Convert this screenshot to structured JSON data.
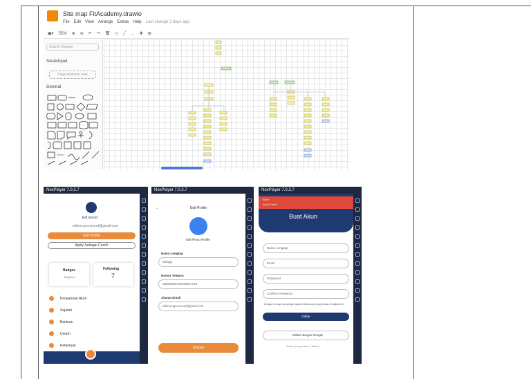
{
  "drawio": {
    "title": "Site map FitAcademy.drawio",
    "menu": [
      "File",
      "Edit",
      "View",
      "Arrange",
      "Extras",
      "Help",
      "Last change 3 days ago"
    ],
    "zoom": "55%",
    "search_placeholder": "Search Shapes",
    "scratchpad": "Scratchpad",
    "drag_hint": "Drag elements here",
    "general": "General"
  },
  "phone1": {
    "app": "NoxPlayer 7.0.2.7",
    "name": "Edi secret",
    "email": "ediencrypt.secret@gmail.com",
    "edit_profile": "Edit Profile",
    "apply": "Apply Sebagai Coach",
    "badges_label": "Badges",
    "badges_value": "Beginner",
    "following_label": "Following",
    "following_value": "7",
    "menu": [
      "Pengaturan Akun",
      "Sejarah",
      "Bantuan",
      "Unduh",
      "Ketentuan"
    ]
  },
  "phone2": {
    "app": "NoxPlayer 7.0.2.7",
    "header": "Edit Profile",
    "photo_label": "Edit Photo Profile",
    "name_label": "Nama Lengkap",
    "name_value": "Edingg",
    "phone_label": "Nomor Telepon",
    "phone_value": "08584960720945687765",
    "email_label": "Alamat Email",
    "email_value": "ediencrypt.secret@gmail.com",
    "save": "Simpan"
  },
  "phone3": {
    "app": "NoxPlayer 7.0.2.7",
    "error_title": "Error",
    "error_msg": "Input Failed",
    "heading": "Buat Akun",
    "fields": [
      "Nama Lengkap",
      "Email",
      "Password",
      "Confirm Password"
    ],
    "terms": "Dengan ini saya menyetujui syarat & ketentuan yang berlaku di aplikasi ini",
    "submit": "Daftar",
    "google": "Daftar dengan Google",
    "login_hint": "Sudah punya akun? Masuk"
  }
}
